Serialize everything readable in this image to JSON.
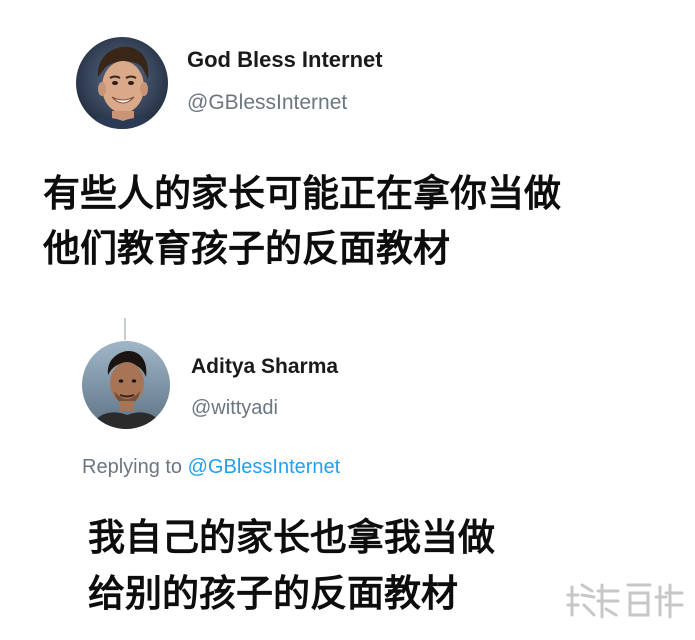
{
  "tweets": [
    {
      "author_name": "God Bless Internet",
      "author_handle": "@GBlessInternet",
      "avatar": "profile-photo",
      "text_lines": [
        "有些人的家长可能正在拿你当做",
        "他们教育孩子的反面教材"
      ]
    },
    {
      "author_name": "Aditya Sharma",
      "author_handle": "@wittyadi",
      "avatar": "profile-photo",
      "replying_prefix": "Replying to",
      "replying_mention": "@GBlessInternet",
      "text_lines": [
        "我自己的家长也拿我当做",
        "给别的孩子的反面教材"
      ]
    }
  ],
  "watermark": {
    "text": "糗事百科"
  },
  "colors": {
    "mention_blue": "#1da1f2",
    "secondary_gray": "#6b7680",
    "thread_line": "#c8cdd2"
  }
}
